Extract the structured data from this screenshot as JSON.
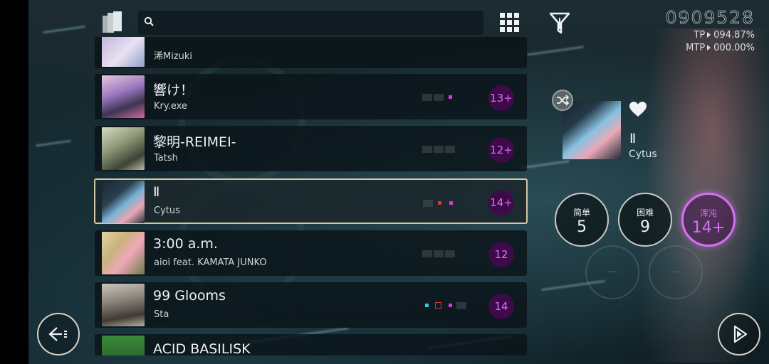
{
  "top": {
    "score": "0909528",
    "tp_label": "TP",
    "tp_value": "094.87%",
    "mtp_label": "MTP",
    "mtp_value": "000.00%",
    "search_placeholder": ""
  },
  "songs": [
    {
      "title": "",
      "artist": "浠Mizuki",
      "level": "",
      "grades": []
    },
    {
      "title": "響け！",
      "artist": "Kry.exe",
      "level": "13+",
      "grades": [
        "",
        "",
        "magenta-dot",
        ""
      ]
    },
    {
      "title": "黎明-REIMEI-",
      "artist": "Tatsh",
      "level": "12+",
      "grades": [
        "",
        "",
        "",
        ""
      ]
    },
    {
      "title": "Ⅱ",
      "artist": "Cytus",
      "level": "14+",
      "grades": [
        "",
        "red-dot",
        "magenta-dot",
        ""
      ]
    },
    {
      "title": "3:00 a.m.",
      "artist": "aioi feat. KAMATA JUNKO",
      "level": "12",
      "grades": [
        "",
        "",
        "",
        ""
      ]
    },
    {
      "title": "99 Glooms",
      "artist": "Sta",
      "level": "14",
      "grades": [
        "cyan-dot",
        "red-square",
        "magenta-dot",
        ""
      ]
    },
    {
      "title": "ACID BASILISK",
      "artist": "",
      "level": "",
      "grades": []
    }
  ],
  "selected": {
    "title": "Ⅱ",
    "artist": "Cytus",
    "favorite_icon": "heart-icon",
    "random_icon": "shuffle-icon"
  },
  "difficulties": [
    {
      "name": "简单",
      "level": "5",
      "state": "normal"
    },
    {
      "name": "困难",
      "level": "9",
      "state": "normal"
    },
    {
      "name": "浑沌",
      "level": "14+",
      "state": "active"
    },
    {
      "name": "",
      "level": "---",
      "state": "locked"
    },
    {
      "name": "",
      "level": "---",
      "state": "locked"
    }
  ],
  "colors": {
    "accent_chaos": "#d96ff2",
    "level_bg": "#3d0b4a",
    "selection_border": "#d2c8a8"
  },
  "icons": {
    "collection": "collection-icon",
    "search": "search-icon",
    "grid": "grid-view-icon",
    "filter": "filter-icon",
    "back": "back-arrow-icon",
    "play": "play-icon"
  }
}
